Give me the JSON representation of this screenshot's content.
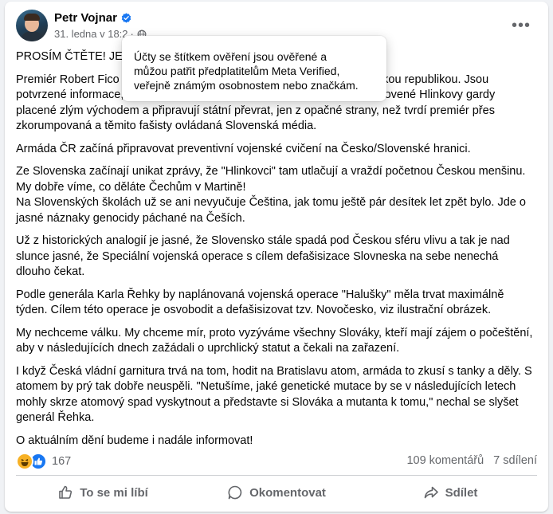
{
  "post": {
    "author": "Petr Vojnar",
    "timestamp": "31. ledna v 18:2",
    "paragraphs": [
      "PROSÍM ČTĚTE! JE NÁM ZLE!",
      "Premiér Robert Fico a jeho vláda vyhlásili válku mezi Českou a Slovenskou republikou. Jsou potvrzené informace, že z Bratislavy vyjíždějí fašistické buňky znovuobnovené Hlinkovy gardy placené zlým východem a připravují státní převrat, jen z opačné strany, než tvrdí premiér přes zkorumpovaná a těmito fašisty ovládaná Slovenská média.",
      "Armáda ČR začíná připravovat preventivní vojenské cvičení na Česko/Slovenské hranici.",
      "Ze Slovenska začínají unikat zprávy, že \"Hlinkovci\" tam utlačují a vraždí početnou Českou menšinu. My dobře víme, co děláte Čechům v Martině!\nNa Slovenských školách už se ani nevyučuje Čeština, jak tomu ještě pár desítek let zpět bylo. Jde o jasné náznaky genocidy páchané na Češích.",
      "Už z historických analogií je jasné, že Slovensko stále spadá pod Českou sféru vlivu a tak je nad slunce jasné, že Speciální vojenská operace s cílem defašisizace Slovneska na sebe nenechá dlouho čekat.",
      "Podle generála Karla Řehky by naplánovaná vojenská operace \"Halušky\" měla trvat maximálně týden. Cílem této operace je osvobodit a defašisizovat tzv. Novočesko, viz ilustrační obrázek.",
      "My nechceme válku. My chceme mír, proto vyzýváme všechny Slováky, kteří mají zájem o počeštění, aby v následujících dnech zažádali o uprchlický statut a čekali na zařazení.",
      "I když Česká vládní garnitura trvá na tom, hodit na Bratislavu atom, armáda to zkusí s tanky a děly. S atomem by prý tak dobře neuspěli. \"Netušíme, jaké genetické mutace by se v následujících letech mohly skrze atomový spad vyskytnout a představte si Slováka a mutanta k tomu,\" nechal se slyšet generál Řehka.",
      "O aktuálním dění budeme i nadále informovat!"
    ]
  },
  "tooltip": {
    "text": "Účty se štítkem ověření jsou ověřené a\nmůžou patřit předplatitelům Meta Verified,\nveřejně známým osobnostem nebo značkám."
  },
  "stats": {
    "reaction_count": "167",
    "comments": "109 komentářů",
    "shares": "7 sdílení"
  },
  "actions": {
    "like": "To se mi líbí",
    "comment": "Okomentovat",
    "share": "Sdílet"
  },
  "icons": {
    "verified": "verified-badge-icon",
    "privacy": "globe-icon",
    "more": "more-options-icon",
    "reactions": [
      "haha-reaction-icon",
      "like-reaction-icon"
    ]
  },
  "colors": {
    "accent": "#1877f2",
    "secondary_text": "#65676b",
    "haha": "#f7b125"
  }
}
